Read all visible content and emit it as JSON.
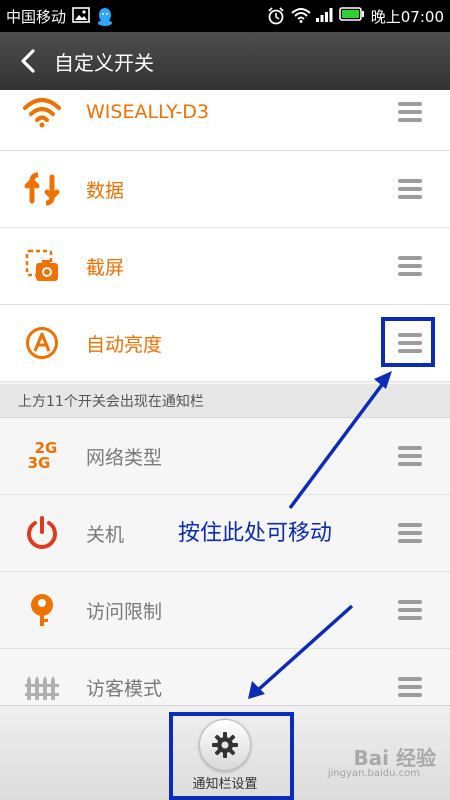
{
  "status_bar": {
    "carrier": "中国移动",
    "time_prefix": "晚上",
    "time": "07:00"
  },
  "header": {
    "title": "自定义开关"
  },
  "toggles_active": [
    {
      "label": "WISEALLY-D3",
      "icon": "wifi-icon"
    },
    {
      "label": "数据",
      "icon": "data-icon"
    },
    {
      "label": "截屏",
      "icon": "screenshot-icon"
    },
    {
      "label": "自动亮度",
      "icon": "auto-brightness-icon"
    }
  ],
  "section": {
    "caption": "上方11个开关会出现在通知栏"
  },
  "toggles_inactive": [
    {
      "label": "网络类型",
      "icon": "network-type-icon",
      "badge_top": "2G",
      "badge_bottom": "3G"
    },
    {
      "label": "关机",
      "icon": "power-icon"
    },
    {
      "label": "访问限制",
      "icon": "key-icon"
    },
    {
      "label": "访客模式",
      "icon": "guest-mode-icon"
    }
  ],
  "bottom": {
    "settings_label": "通知栏设置"
  },
  "annotation": {
    "text": "按住此处可移动"
  },
  "watermark": {
    "brand": "Bai 经验",
    "url": "jingyan.baidu.com"
  },
  "colors": {
    "accent": "#f07000",
    "annotation": "#0b2bb8",
    "power_red": "#e03a1e"
  }
}
